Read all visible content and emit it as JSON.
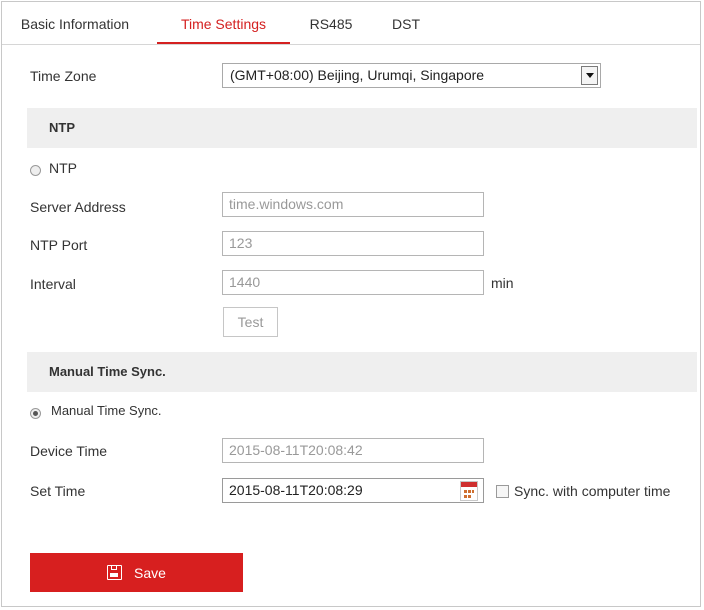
{
  "tabs": [
    {
      "label": "Basic Information"
    },
    {
      "label": "Time Settings"
    },
    {
      "label": "RS485"
    },
    {
      "label": "DST"
    }
  ],
  "active_tab": "Time Settings",
  "time_zone": {
    "label": "Time Zone",
    "value": "(GMT+08:00) Beijing, Urumqi, Singapore"
  },
  "ntp": {
    "section_title": "NTP",
    "radio_label": "NTP",
    "selected": false,
    "server_address_label": "Server Address",
    "server_address_value": "time.windows.com",
    "port_label": "NTP Port",
    "port_value": "123",
    "interval_label": "Interval",
    "interval_value": "1440",
    "interval_unit": "min",
    "test_label": "Test"
  },
  "manual": {
    "section_title": "Manual Time Sync.",
    "radio_label": "Manual Time Sync.",
    "selected": true,
    "device_time_label": "Device Time",
    "device_time_value": "2015-08-11T20:08:42",
    "set_time_label": "Set Time",
    "set_time_value": "2015-08-11T20:08:29",
    "sync_label": "Sync. with computer time",
    "sync_checked": false
  },
  "save_label": "Save",
  "colors": {
    "accent": "#d71f1f",
    "section_bg": "#efefef"
  },
  "icons": {
    "select_arrow": "chevron-down-icon",
    "calendar": "calendar-icon",
    "save": "floppy-disk-icon"
  }
}
